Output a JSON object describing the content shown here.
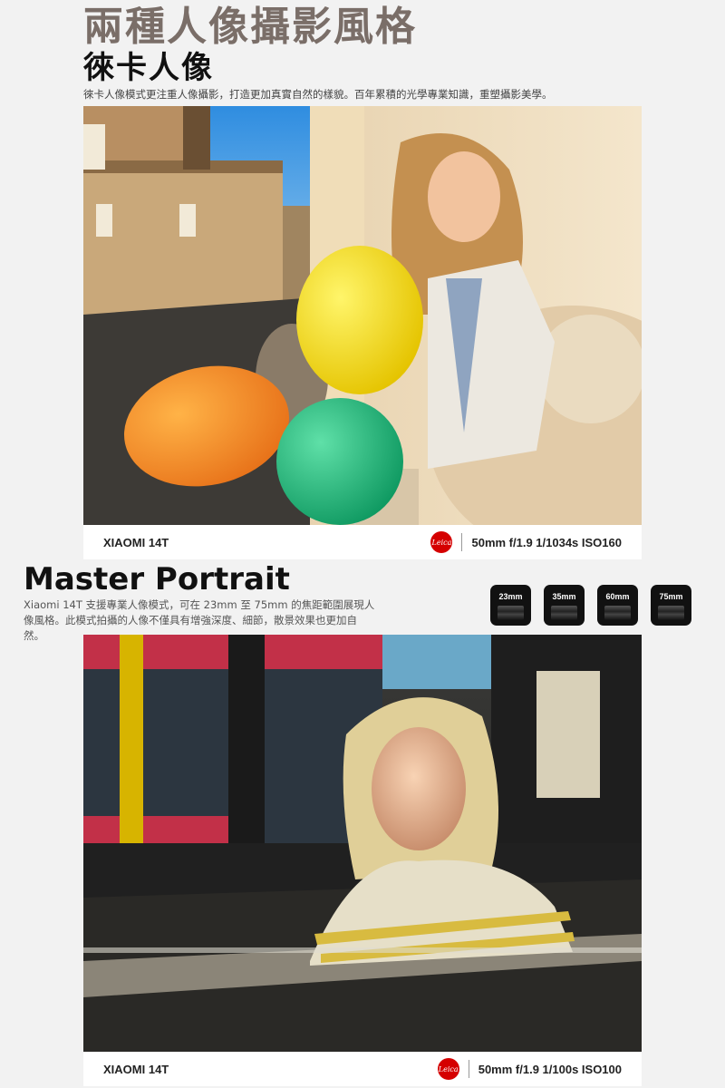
{
  "header": {
    "title": "兩種人像攝影風格",
    "subtitle": "徠卡人像",
    "intro": "徠卡人像模式更注重人像攝影，打造更加真實自然的樣貌。百年累積的光學專業知識，重塑攝影美學。"
  },
  "photo1": {
    "model": "XIAOMI 14T",
    "brand": "Leica",
    "specs": "50mm  f/1.9  1/1034s  ISO160"
  },
  "master": {
    "title": "Master Portrait",
    "desc": "Xiaomi 14T 支援專業人像模式，可在 23mm 至 75mm 的焦距範圍展現人像風格。此模式拍攝的人像不僅具有增強深度、細節，散景效果也更加自然。",
    "lenses": [
      "23mm",
      "35mm",
      "60mm",
      "75mm"
    ]
  },
  "photo2": {
    "model": "XIAOMI 14T",
    "brand": "Leica",
    "specs": "50mm  f/1.9  1/100s  ISO100"
  },
  "colors": {
    "leica_red": "#d50000",
    "headline": "#7a6e68"
  }
}
